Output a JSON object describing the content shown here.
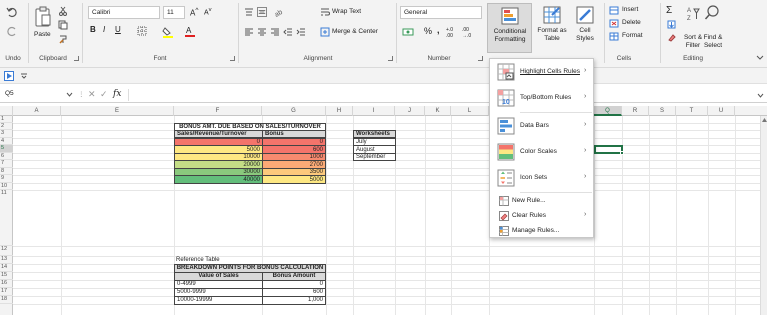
{
  "colors": {
    "red": "#f4746b",
    "orange": "#fbaa76",
    "yellow": "#fee883",
    "lightgreen": "#c4dd86",
    "green": "#8ac97d",
    "darkgreen": "#63be7b",
    "header_gray": "#d9d9d9",
    "selection_green": "#217346"
  },
  "ribbon": {
    "undo_label": "Undo",
    "clipboard_label": "Clipboard",
    "paste_label": "Paste",
    "font_name": "Calibri",
    "font_size": "11",
    "font_label": "Font",
    "alignment_label": "Alignment",
    "wrap_text_label": "Wrap Text",
    "merge_center_label": "Merge & Center",
    "number_format": "General",
    "number_label": "Number",
    "conditional_formatting_label": "Conditional Formatting",
    "format_as_table_label": "Format as Table",
    "cell_styles_label": "Cell Styles",
    "insert_label": "Insert",
    "delete_label": "Delete",
    "format_label": "Format",
    "cells_label": "Cells",
    "sort_filter_label": "Sort & Filter",
    "find_select_label": "Find & Select",
    "editing_label": "Editing"
  },
  "formula_bar": {
    "name_box": "Q5",
    "fx_label": "fx",
    "formula": ""
  },
  "columns": [
    "A",
    "E",
    "F",
    "G",
    "H",
    "I",
    "J",
    "K",
    "L",
    "Q",
    "R",
    "S",
    "T",
    "U"
  ],
  "rows": [
    "1",
    "2",
    "3",
    "4",
    "5",
    "6",
    "7",
    "8",
    "9",
    "10",
    "11",
    "12",
    "13",
    "14",
    "15",
    "16",
    "17",
    "18"
  ],
  "bonus_table": {
    "title": "BONUS AMT. DUE BASED ON SALES/TURNOVER",
    "header_sales": "Sales/Revenue/Turnover",
    "header_bonus": "Bonus",
    "rows": [
      {
        "sales": "0",
        "bonus": "0"
      },
      {
        "sales": "5000",
        "bonus": "600"
      },
      {
        "sales": "10000",
        "bonus": "1000"
      },
      {
        "sales": "20000",
        "bonus": "2700"
      },
      {
        "sales": "30000",
        "bonus": "3500"
      },
      {
        "sales": "40000",
        "bonus": "5000"
      }
    ]
  },
  "worksheets": {
    "header": "Worksheets",
    "items": [
      "July",
      "August",
      "September"
    ]
  },
  "reference_table": {
    "caption": "Reference Table",
    "title": "BREAKDOWN POINTS FOR BONUS CALCULATION",
    "header_value": "Value of Sales",
    "header_bonus": "Bonus Amount",
    "rows": [
      {
        "range": "0-4999",
        "bonus": "0"
      },
      {
        "range": "5000-9999",
        "bonus": "600"
      },
      {
        "range": "10000-19999",
        "bonus": "1,000"
      }
    ]
  },
  "cf_menu": {
    "items": [
      {
        "label": "Highlight Cells Rules",
        "icon": "highlight-cells-icon",
        "submenu": true
      },
      {
        "label": "Top/Bottom Rules",
        "icon": "top-bottom-icon",
        "submenu": true
      },
      {
        "label": "Data Bars",
        "icon": "data-bars-icon",
        "submenu": true
      },
      {
        "label": "Color Scales",
        "icon": "color-scales-icon",
        "submenu": true
      },
      {
        "label": "Icon Sets",
        "icon": "icon-sets-icon",
        "submenu": true
      },
      {
        "label": "New Rule...",
        "icon": "new-rule-icon",
        "submenu": false
      },
      {
        "label": "Clear Rules",
        "icon": "clear-rules-icon",
        "submenu": true
      },
      {
        "label": "Manage Rules...",
        "icon": "manage-rules-icon",
        "submenu": false
      }
    ]
  }
}
